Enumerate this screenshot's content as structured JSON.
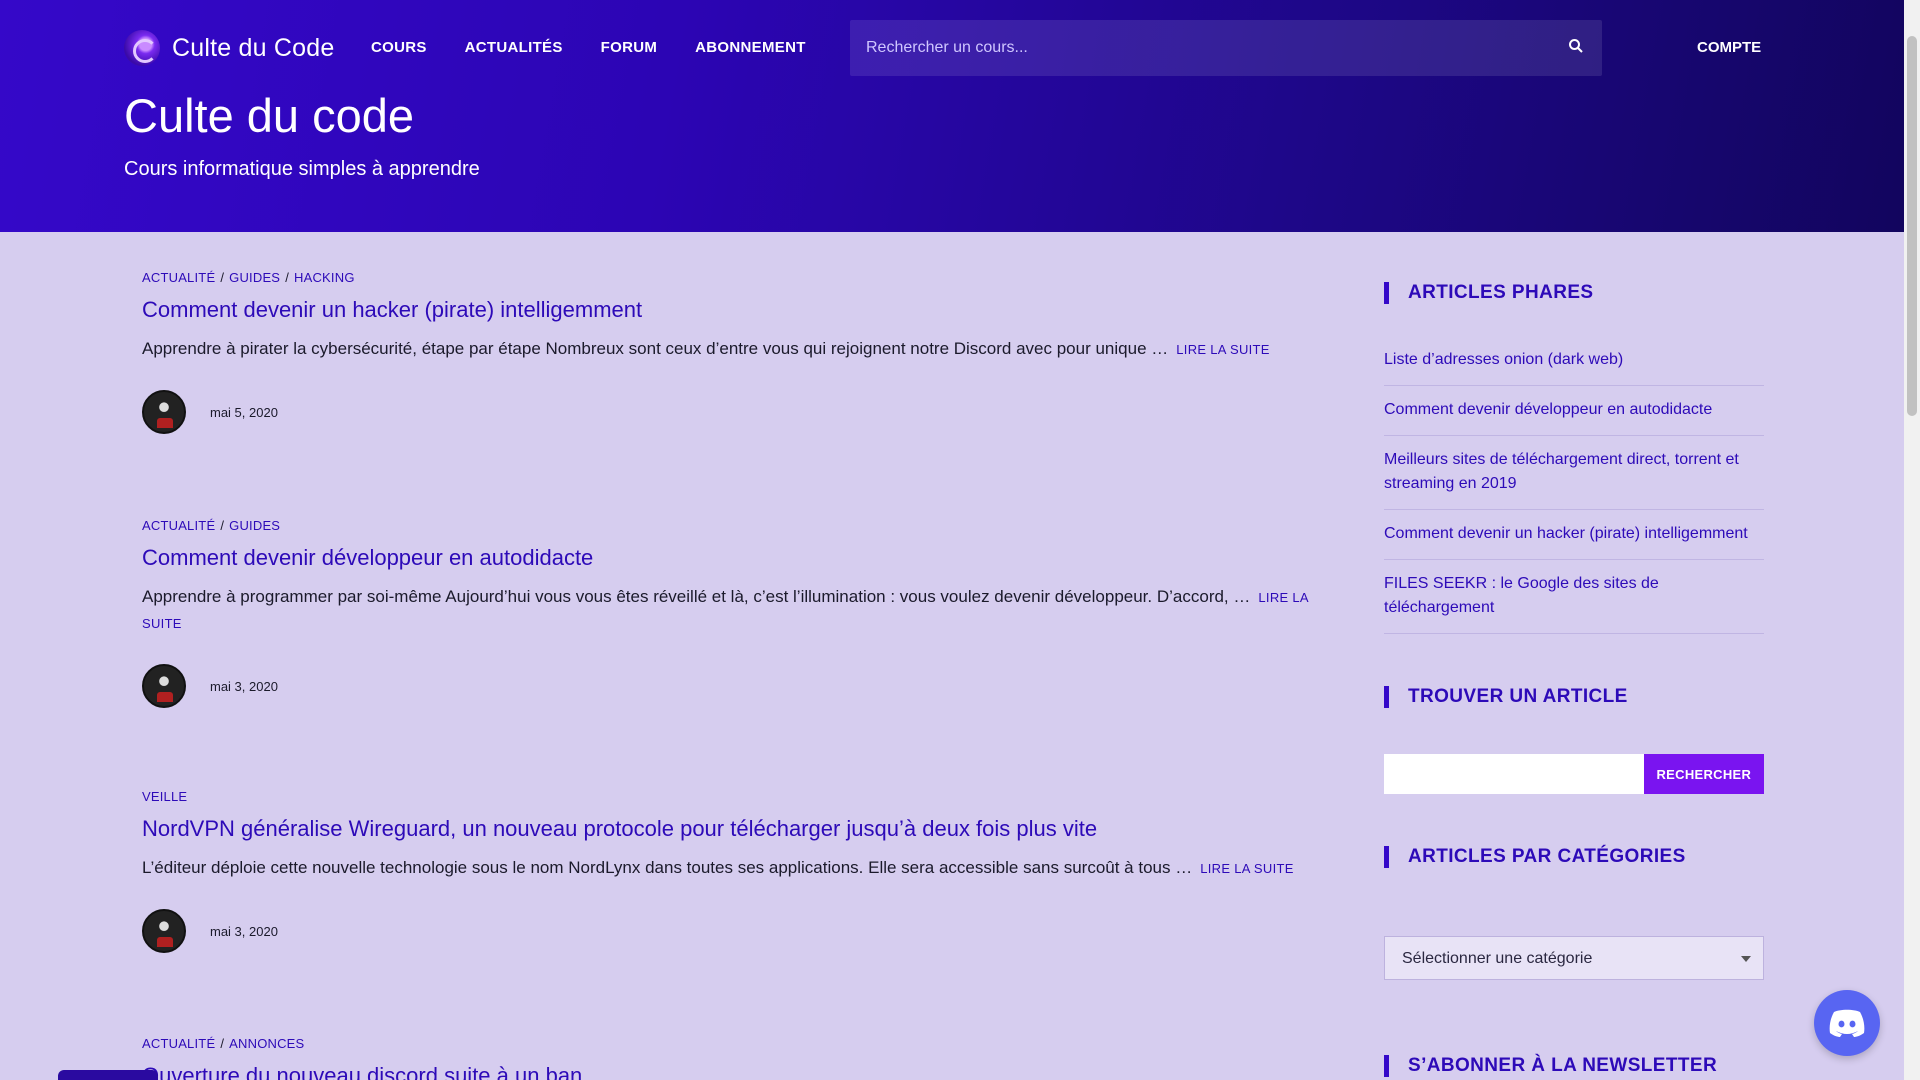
{
  "header": {
    "logo_text": "Culte du Code",
    "nav": [
      "COURS",
      "ACTUALITÉS",
      "FORUM",
      "ABONNEMENT"
    ],
    "search_placeholder": "Rechercher un cours...",
    "account_label": "COMPTE",
    "site_title": "Culte du code",
    "tagline": "Cours informatique simples à apprendre"
  },
  "articles": [
    {
      "categories": [
        "ACTUALITÉ",
        "GUIDES",
        "HACKING"
      ],
      "title": "Comment devenir un hacker (pirate) intelligemment",
      "excerpt": "Apprendre à pirater la cybersécurité, étape par étape Nombreux sont ceux d’entre vous qui rejoignent notre Discord avec pour unique …",
      "read_more": "LIRE LA SUITE",
      "date": "mai 5, 2020"
    },
    {
      "categories": [
        "ACTUALITÉ",
        "GUIDES"
      ],
      "title": "Comment devenir développeur en autodidacte",
      "excerpt": "Apprendre à programmer par soi-même Aujourd’hui vous vous êtes réveillé et là, c’est l’illumination : vous voulez devenir développeur. D’accord, …",
      "read_more": "LIRE LA SUITE",
      "date": "mai 3, 2020"
    },
    {
      "categories": [
        "VEILLE"
      ],
      "title": "NordVPN généralise Wireguard, un nouveau protocole pour télécharger jusqu’à deux fois plus vite",
      "excerpt": "L’éditeur déploie cette nouvelle technologie sous le nom NordLynx dans toutes ses applications. Elle sera accessible sans surcoût à tous …",
      "read_more": "LIRE LA SUITE",
      "date": "mai 3, 2020"
    },
    {
      "categories": [
        "ACTUALITÉ",
        "ANNONCES"
      ],
      "title": "Ouverture du nouveau discord suite à un ban"
    }
  ],
  "sidebar": {
    "featured_title": "ARTICLES PHARES",
    "featured": [
      "Liste d’adresses onion (dark web)",
      "Comment devenir développeur en autodidacte",
      "Meilleurs sites de téléchargement direct, torrent et streaming en 2019",
      "Comment devenir un hacker (pirate) intelligemment",
      "FILES SEEKR : le Google des sites de téléchargement"
    ],
    "find_title": "TROUVER UN ARTICLE",
    "search_button": "RECHERCHER",
    "categories_title": "ARTICLES PAR CATÉGORIES",
    "category_select": "Sélectionner une catégorie",
    "newsletter_title": "S’ABONNER À LA NEWSLETTER"
  },
  "colors": {
    "header_start": "#3508c9",
    "header_end": "#12055e",
    "page_bg": "#d6cdef",
    "link": "#2d0ab8",
    "button": "#7a14f0",
    "discord": "#5865f2"
  },
  "icons": [
    "logo-icon",
    "search-icon",
    "discord-icon",
    "chevron-down-icon"
  ]
}
